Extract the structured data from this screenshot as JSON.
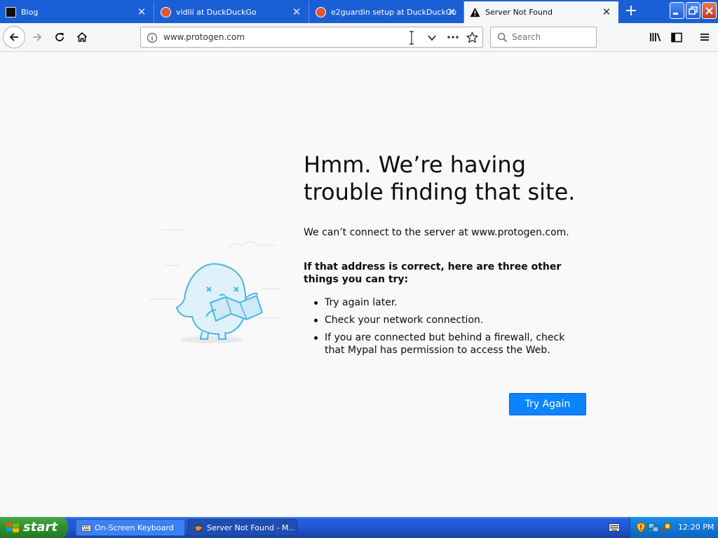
{
  "tabs": [
    {
      "label": "Blog",
      "icon": "blog-favicon",
      "selected": false
    },
    {
      "label": "vidlii at DuckDuckGo",
      "icon": "duckduckgo-favicon",
      "selected": false
    },
    {
      "label": "e2guardin setup at DuckDuckGo",
      "icon": "duckduckgo-favicon",
      "selected": false
    },
    {
      "label": "Server Not Found",
      "icon": "warning-icon",
      "selected": true
    }
  ],
  "toolbar": {
    "url": "www.protogen.com",
    "search_placeholder": "Search"
  },
  "error_page": {
    "title": "Hmm. We’re having trouble finding that site.",
    "description": "We can’t connect to the server at www.protogen.com.",
    "suggestions_heading": "If that address is correct, here are three other things you can try:",
    "suggestions": [
      "Try again later.",
      "Check your network connection.",
      "If you are connected but behind a firewall, check that Mypal has permission to access the Web."
    ],
    "try_again_label": "Try Again"
  },
  "taskbar": {
    "start_label": "start",
    "tasks": [
      {
        "label": "On-Screen Keyboard",
        "active": false
      },
      {
        "label": "Server Not Found - M...",
        "active": true
      }
    ],
    "clock": "12:20 PM"
  },
  "colors": {
    "tab_strip": "#1b5fd6",
    "accent_button": "#0a84ff",
    "page_background": "#f9f9fa"
  }
}
